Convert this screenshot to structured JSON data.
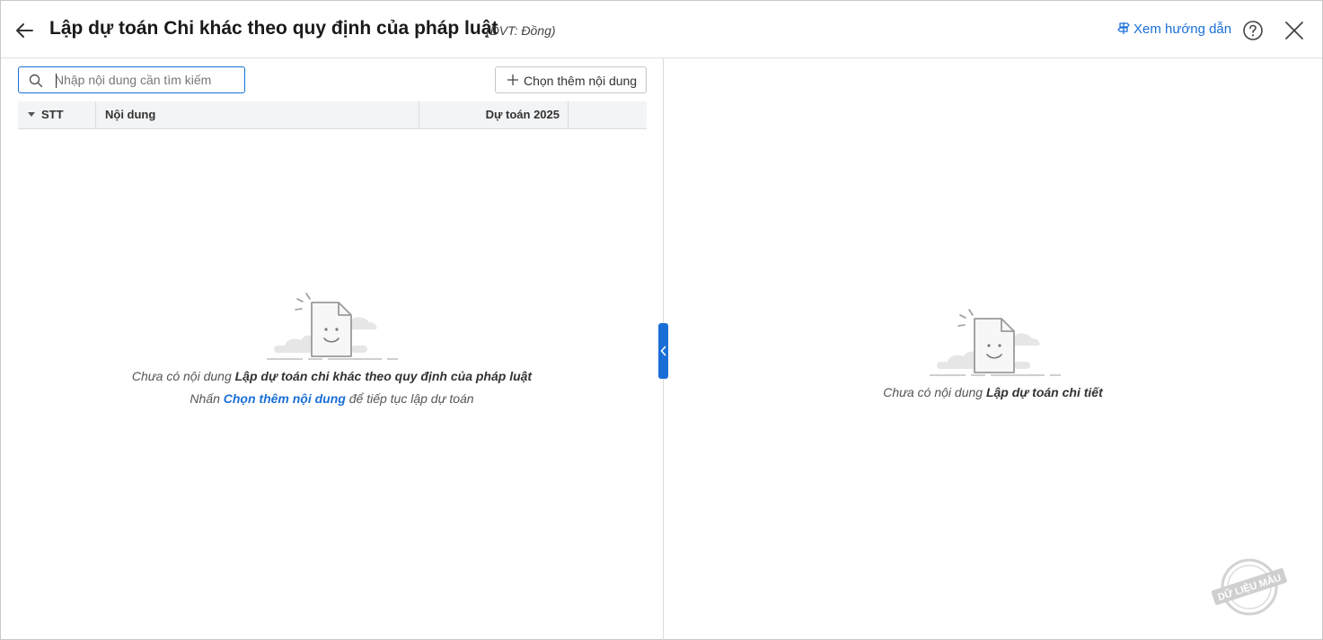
{
  "header": {
    "title": "Lập dự toán Chi khác theo quy định của pháp luật",
    "unit": "(ĐVT: Đồng)",
    "guide_label": "Xem hướng dẫn"
  },
  "left": {
    "search_placeholder": "Nhập nội dung cần tìm kiếm",
    "add_label": "Chọn thêm nội dung",
    "columns": [
      "STT",
      "Nội dung",
      "Dự toán 2025"
    ],
    "empty_prefix": "Chưa có nội dung ",
    "empty_bold": "Lập dự toán chi khác theo quy định của pháp luật",
    "hint_prefix": "Nhấn ",
    "hint_link": "Chọn thêm nội dung",
    "hint_suffix": " để tiếp tục lập dự toán"
  },
  "right": {
    "empty_prefix": "Chưa có nội dung ",
    "empty_bold": "Lập dự toán chi tiết"
  },
  "watermark": "DỮ LIỆU MẪU",
  "colors": {
    "accent": "#1a6fd6",
    "header_bg": "#f3f4f6"
  }
}
